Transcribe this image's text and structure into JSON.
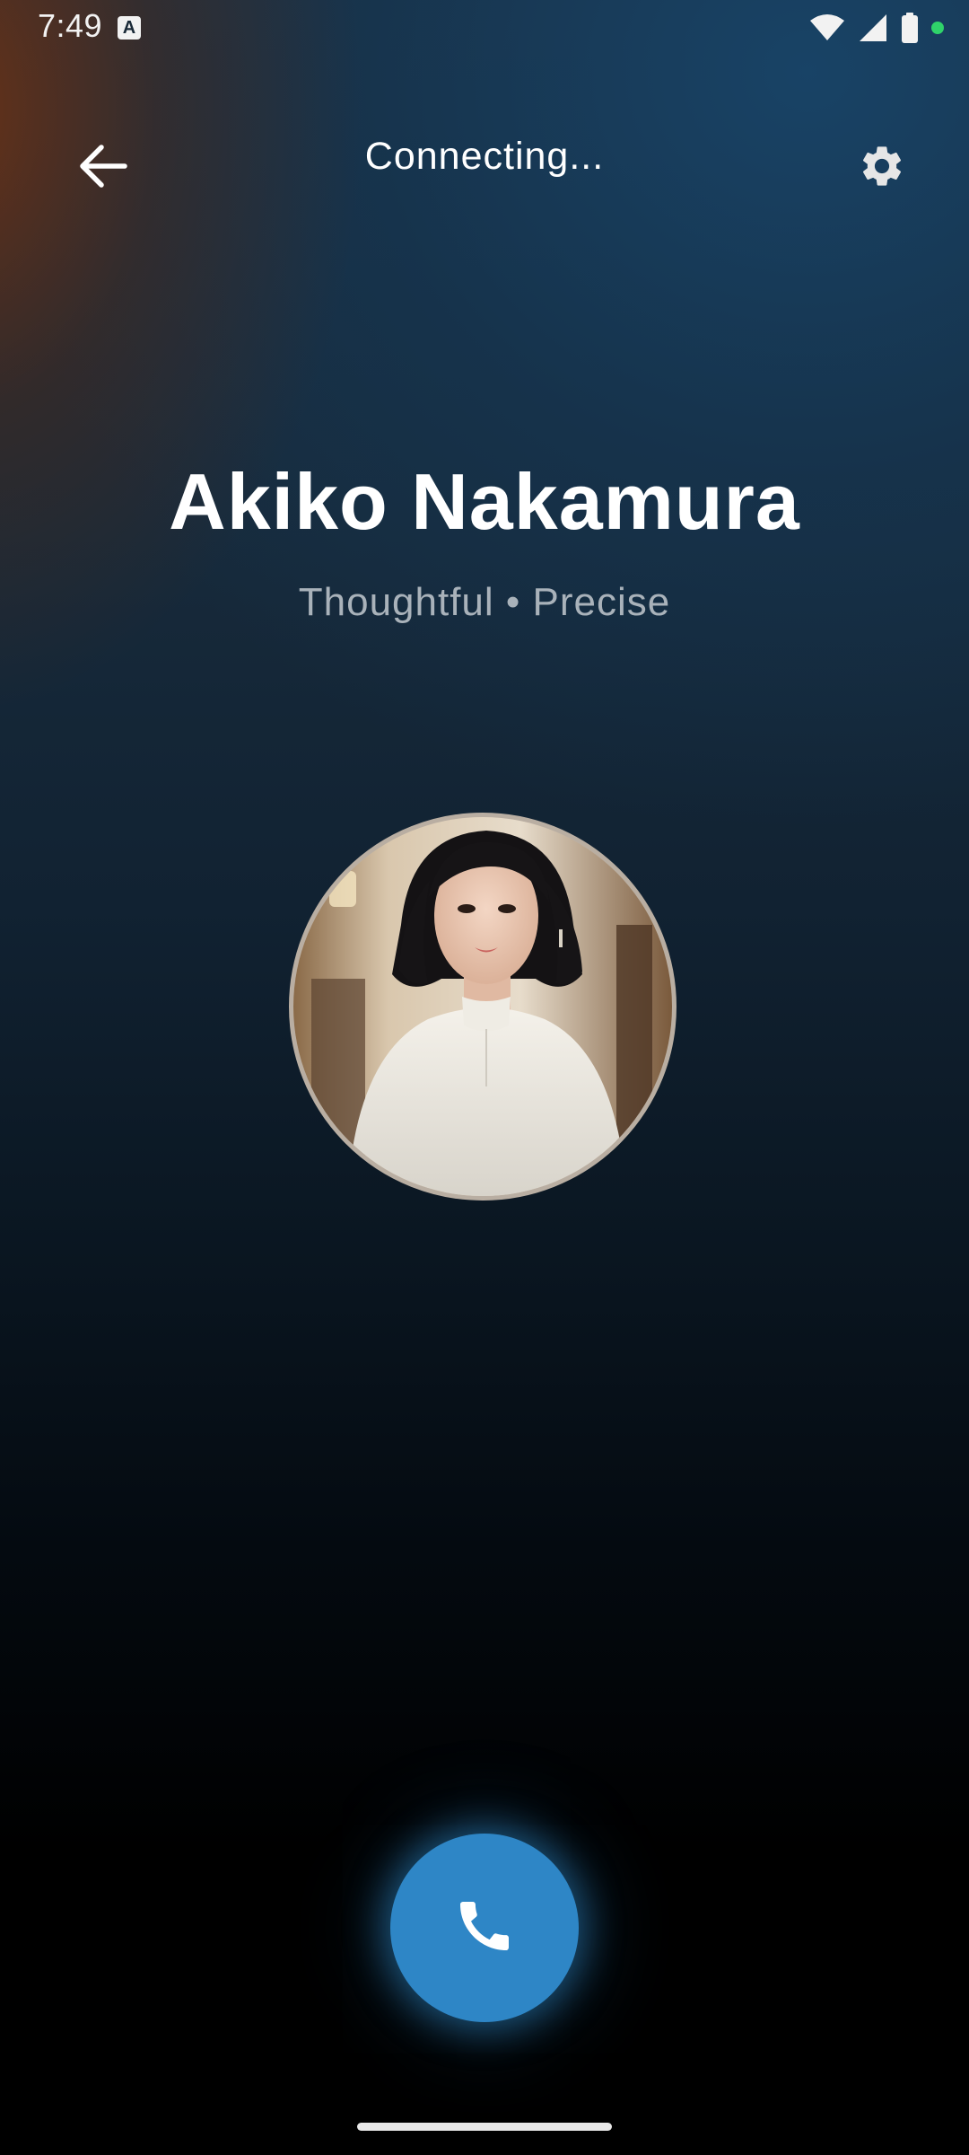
{
  "status_bar": {
    "time": "7:49",
    "icons": [
      "a-app-icon",
      "wifi-icon",
      "signal-icon",
      "battery-icon",
      "privacy-dot-icon"
    ],
    "privacy_dot_color": "#2fd36a"
  },
  "app_bar": {
    "title": "Connecting...",
    "back_icon": "arrow-left-icon",
    "settings_icon": "gear-icon"
  },
  "contact": {
    "name": "Akiko Nakamura",
    "traits": "Thoughtful • Precise",
    "avatar": "portrait-photo"
  },
  "call_button": {
    "icon": "phone-icon",
    "color": "#2e86c6"
  },
  "colors": {
    "accent": "#2e86c6",
    "text_primary": "#ffffff",
    "text_secondary": "#a9b2ba"
  }
}
